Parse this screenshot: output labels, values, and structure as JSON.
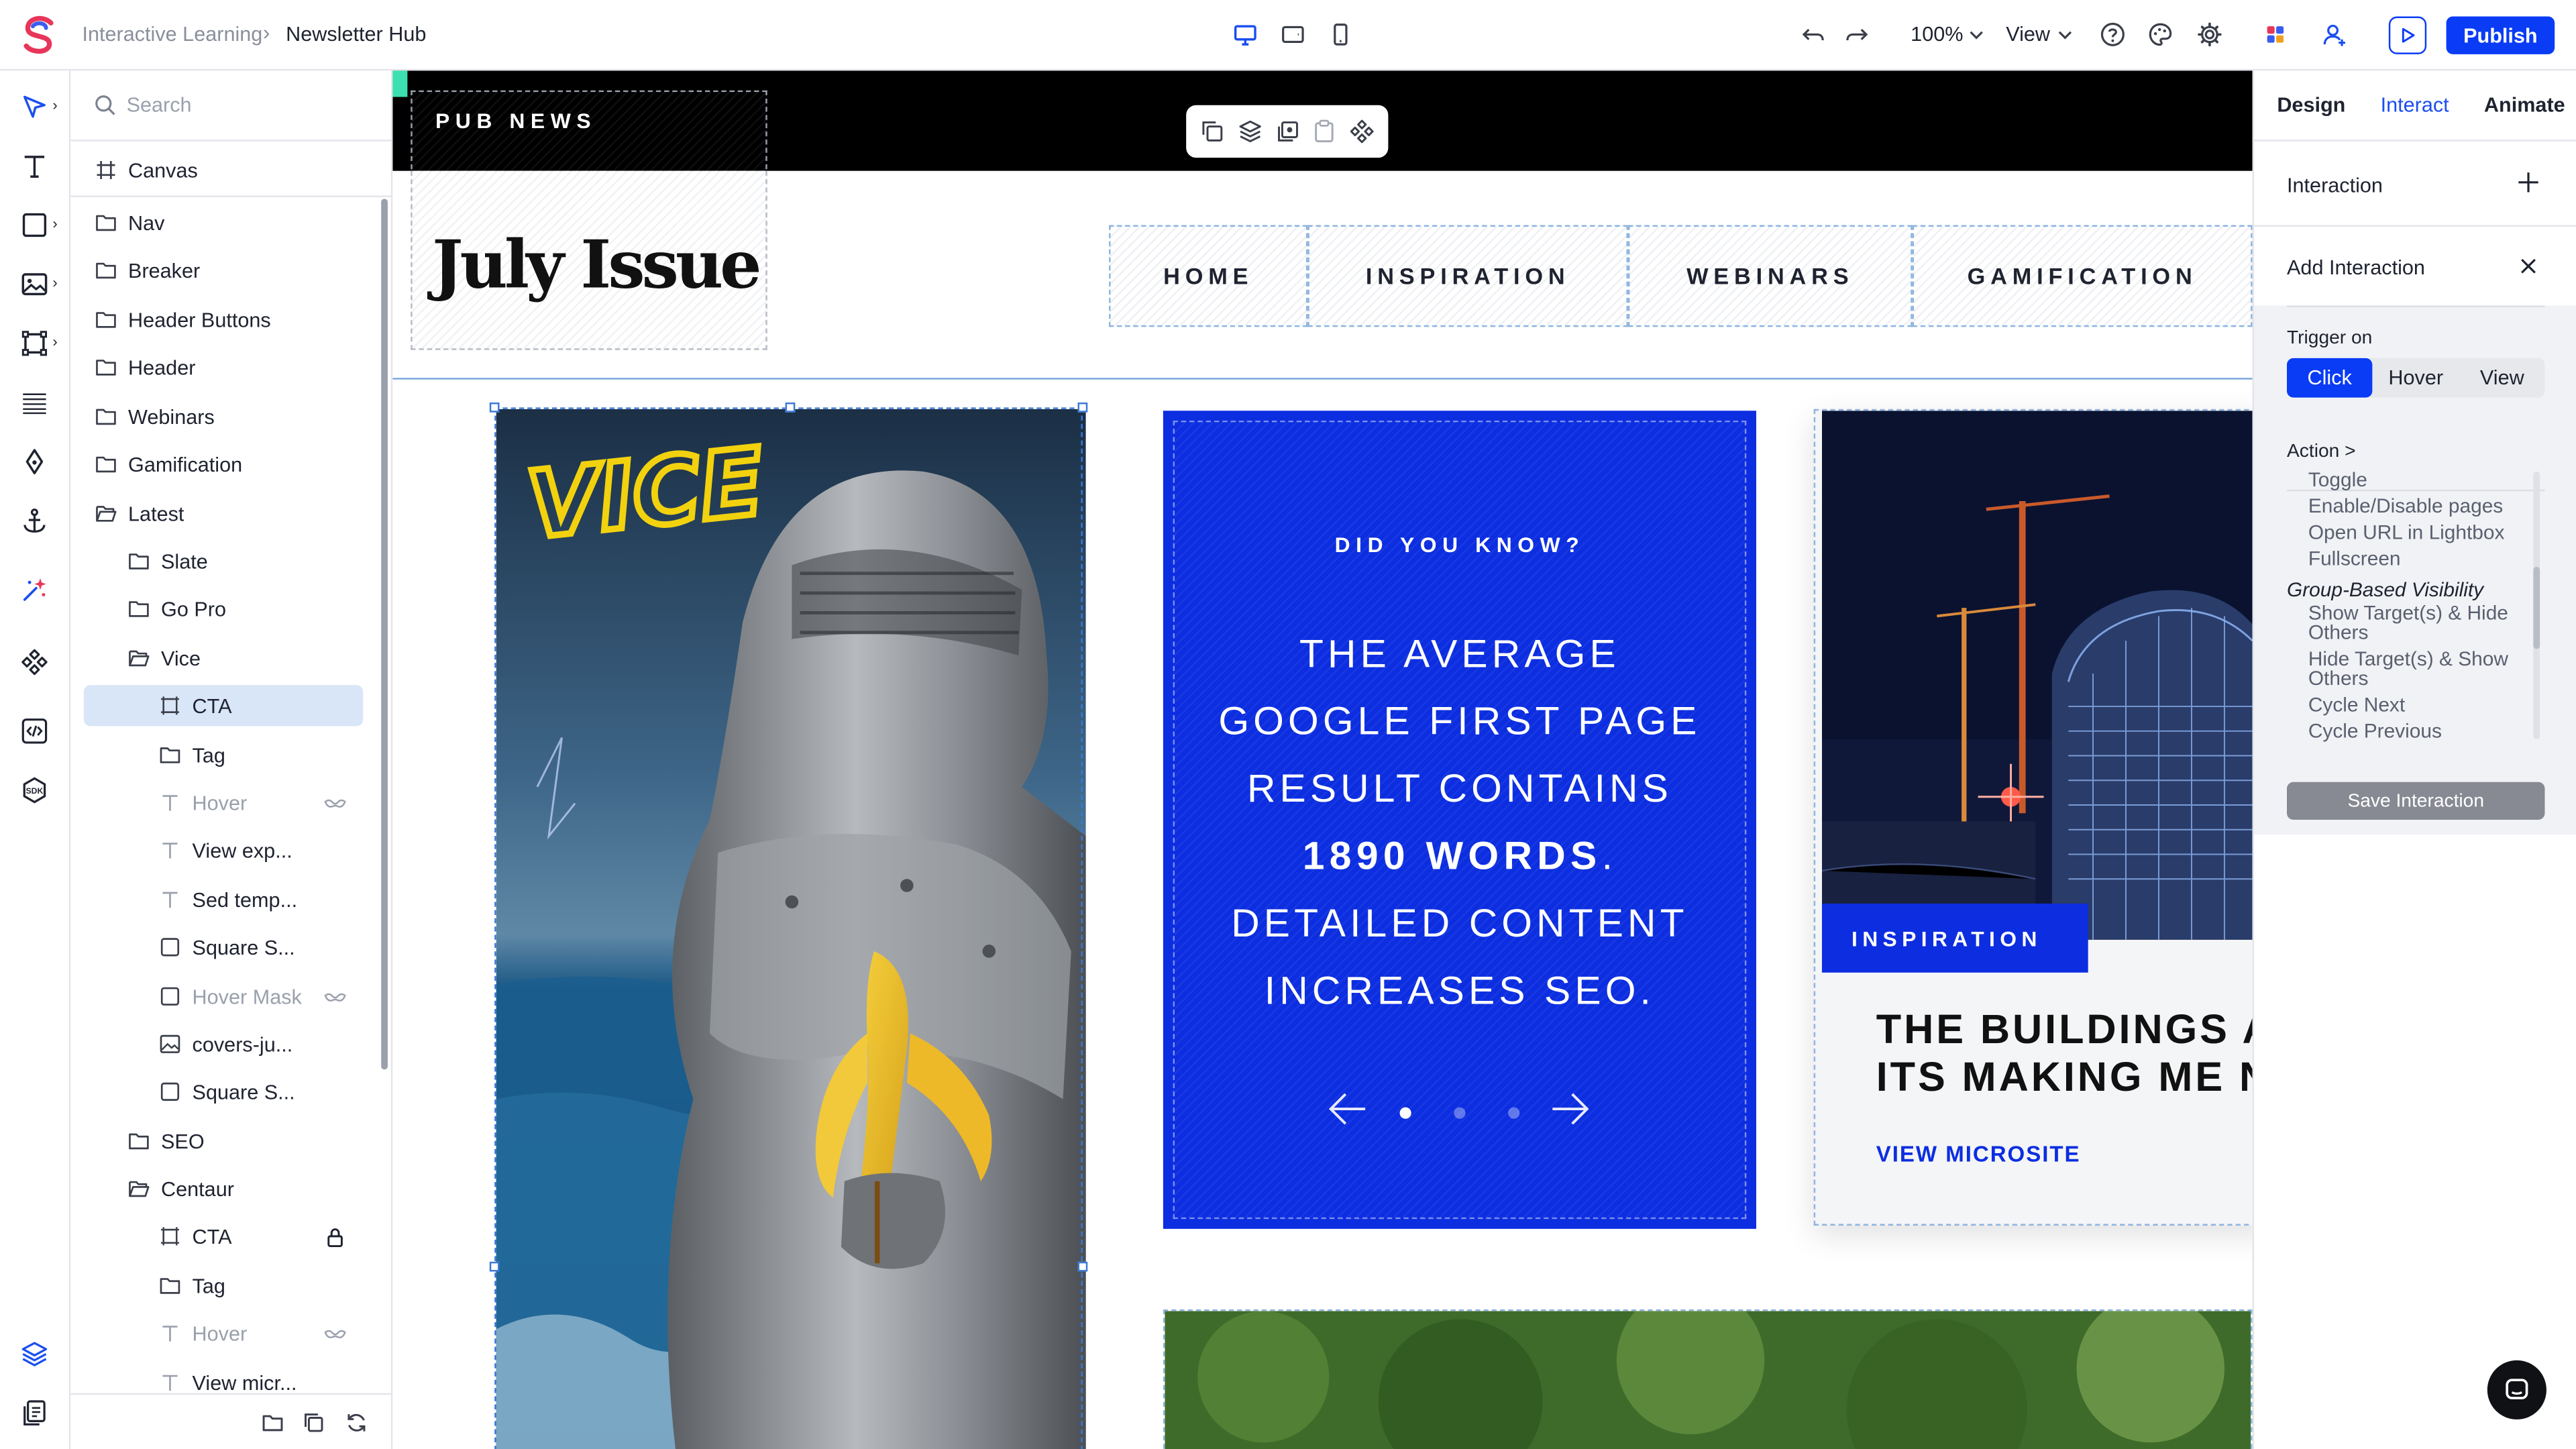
{
  "app": {
    "breadcrumb_parent": "Interactive Learning",
    "breadcrumb_separator": "›",
    "breadcrumb_current": "Newsletter Hub",
    "zoom": "100%",
    "view_label": "View",
    "publish_label": "Publish",
    "accent_color": "#0a3cf5"
  },
  "layers": {
    "search_placeholder": "Search",
    "canvas_label": "Canvas",
    "items": [
      {
        "label": "Nav",
        "icon": "folder-icon"
      },
      {
        "label": "Breaker",
        "icon": "folder-icon"
      },
      {
        "label": "Header Buttons",
        "icon": "folder-icon"
      },
      {
        "label": "Header",
        "icon": "folder-icon"
      },
      {
        "label": "Webinars",
        "icon": "folder-icon"
      },
      {
        "label": "Gamification",
        "icon": "folder-icon"
      },
      {
        "label": "Latest",
        "icon": "folder-open-icon"
      },
      {
        "label": "Slate",
        "icon": "folder-icon"
      },
      {
        "label": "Go Pro",
        "icon": "folder-icon"
      },
      {
        "label": "Vice",
        "icon": "folder-open-icon"
      },
      {
        "label": "CTA",
        "icon": "frame-icon"
      },
      {
        "label": "Tag",
        "icon": "folder-icon"
      },
      {
        "label": "Hover",
        "icon": "text-icon"
      },
      {
        "label": "View exp...",
        "icon": "text-icon"
      },
      {
        "label": "Sed temp...",
        "icon": "text-icon"
      },
      {
        "label": "Square S...",
        "icon": "square-icon"
      },
      {
        "label": "Hover Mask",
        "icon": "square-icon"
      },
      {
        "label": "covers-ju...",
        "icon": "image-icon"
      },
      {
        "label": "Square S...",
        "icon": "square-icon"
      },
      {
        "label": "SEO",
        "icon": "folder-icon"
      },
      {
        "label": "Centaur",
        "icon": "folder-open-icon"
      },
      {
        "label": "CTA",
        "icon": "frame-icon"
      },
      {
        "label": "Tag",
        "icon": "folder-icon"
      },
      {
        "label": "Hover",
        "icon": "text-icon"
      },
      {
        "label": "View micr...",
        "icon": "text-icon"
      }
    ]
  },
  "canvas": {
    "brand": "PUB NEWS",
    "issue_title": "July Issue",
    "nav": [
      "HOME",
      "INSPIRATION",
      "WEBINARS",
      "GAMIFICATION"
    ],
    "vice_logo": "VICE",
    "card_kicker": "DID YOU KNOW?",
    "fact_line1": "THE AVERAGE",
    "fact_line2": "GOOGLE FIRST PAGE",
    "fact_line3": "RESULT CONTAINS",
    "fact_bold": "1890 WORDS",
    "fact_after_bold": ".",
    "fact_line5": "DETAILED CONTENT",
    "fact_line6": "INCREASES SEO.",
    "carousel_active_index": 1,
    "carousel_total": 3,
    "tag": "INSPIRATION",
    "building_title_l1": "THE BUILDINGS A",
    "building_title_l2": "ITS MAKING ME N",
    "microsite_link": "VIEW MICROSITE",
    "card_blue": "#0c2ee0"
  },
  "panel": {
    "tabs": [
      "Design",
      "Interact",
      "Animate"
    ],
    "active_tab": "Interact",
    "interaction_label": "Interaction",
    "add_interaction_label": "Add Interaction",
    "trigger_label": "Trigger on",
    "triggers": [
      "Click",
      "Hover",
      "View"
    ],
    "active_trigger": "Click",
    "action_label": "Action  >",
    "actions": [
      {
        "text": "Toggle"
      },
      {
        "text": "Enable/Disable pages"
      },
      {
        "text": "Open URL in Lightbox"
      },
      {
        "text": "Fullscreen"
      },
      {
        "text": "Group-Based Visibility",
        "header": true
      },
      {
        "text": "Show Target(s) & Hide"
      },
      {
        "text": "Others"
      },
      {
        "text": "Hide Target(s) & Show"
      },
      {
        "text": "Others"
      },
      {
        "text": "Cycle Next"
      },
      {
        "text": "Cycle Previous"
      }
    ],
    "save_label": "Save Interaction"
  }
}
